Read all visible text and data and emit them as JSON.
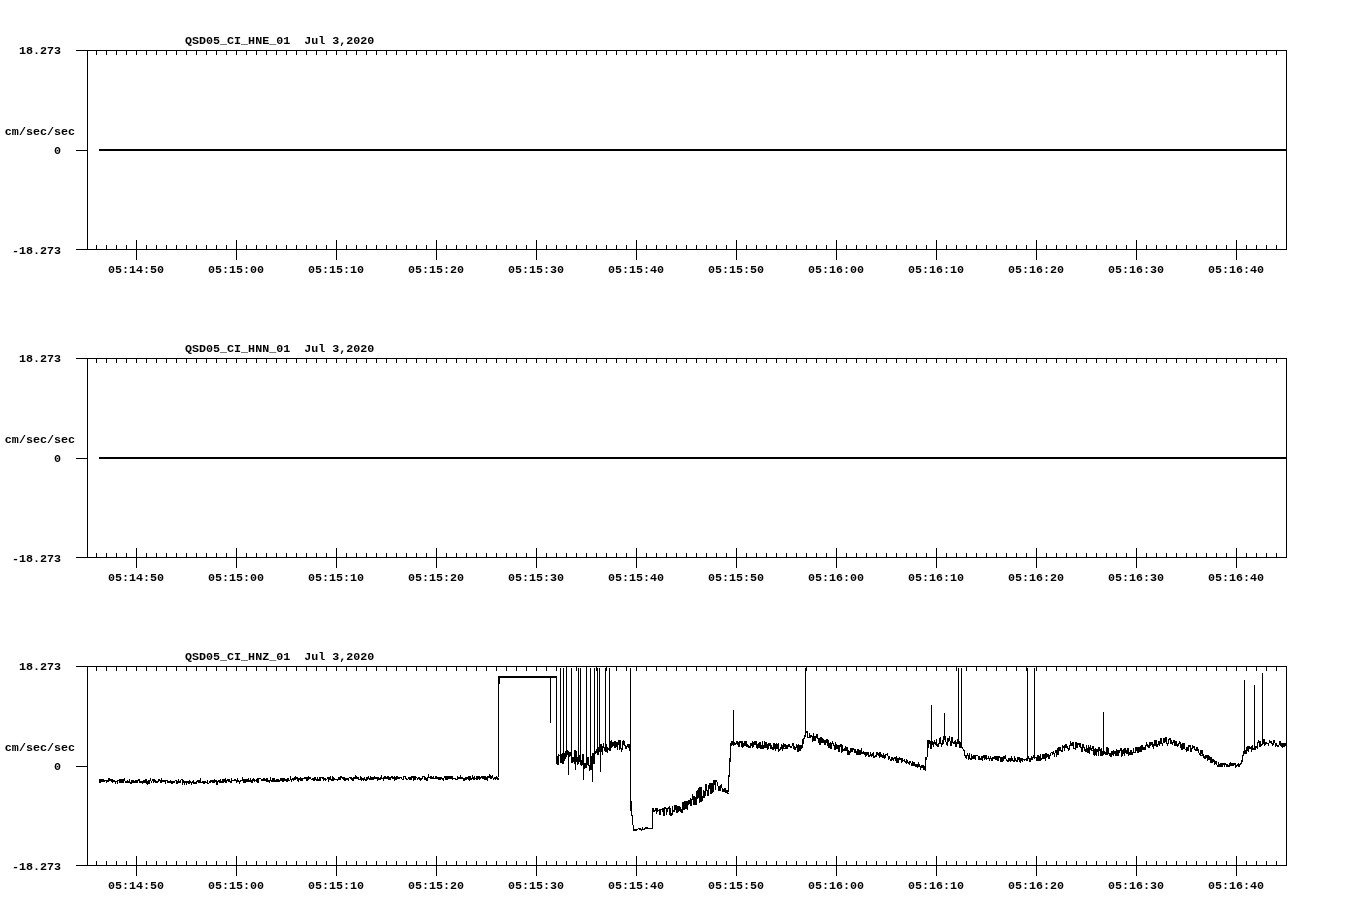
{
  "panels": [
    {
      "kind": "flat",
      "station": "QSD05_CI_HNE_01",
      "date": "Jul 3,2020",
      "y_max": "18.273",
      "y_unit": "cm/sec/sec",
      "y_zero": "0",
      "y_min": "-18.273",
      "time_labels": [
        "05:14:50",
        "05:15:00",
        "05:15:10",
        "05:15:20",
        "05:15:30",
        "05:15:40",
        "05:15:50",
        "05:16:00",
        "05:16:10",
        "05:16:20",
        "05:16:30",
        "05:16:40"
      ]
    },
    {
      "kind": "flat",
      "station": "QSD05_CI_HNN_01",
      "date": "Jul 3,2020",
      "y_max": "18.273",
      "y_unit": "cm/sec/sec",
      "y_zero": "0",
      "y_min": "-18.273",
      "time_labels": [
        "05:14:50",
        "05:15:00",
        "05:15:10",
        "05:15:20",
        "05:15:30",
        "05:15:40",
        "05:15:50",
        "05:16:00",
        "05:16:10",
        "05:16:20",
        "05:16:30",
        "05:16:40"
      ]
    },
    {
      "kind": "waveform",
      "station": "QSD05_CI_HNZ_01",
      "date": "Jul 3,2020",
      "y_max": "18.273",
      "y_unit": "cm/sec/sec",
      "y_zero": "0",
      "y_min": "-18.273",
      "time_labels": [
        "05:14:50",
        "05:15:00",
        "05:15:10",
        "05:15:20",
        "05:15:30",
        "05:15:40",
        "05:15:50",
        "05:16:00",
        "05:16:10",
        "05:16:20",
        "05:16:30",
        "05:16:40"
      ]
    }
  ]
}
